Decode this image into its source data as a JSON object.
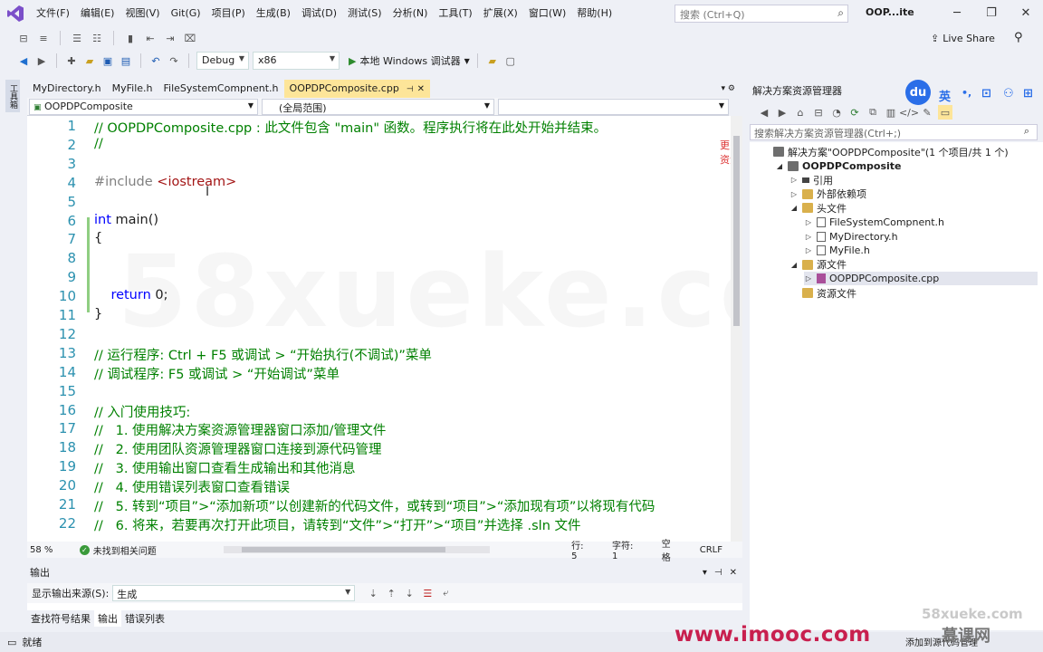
{
  "menu": [
    "文件(F)",
    "编辑(E)",
    "视图(V)",
    "Git(G)",
    "项目(P)",
    "生成(B)",
    "调试(D)",
    "测试(S)",
    "分析(N)",
    "工具(T)",
    "扩展(X)",
    "窗口(W)",
    "帮助(H)"
  ],
  "search_placeholder": "搜索 (Ctrl+Q)",
  "window_title": "OOP...ite",
  "live_share": "Live Share",
  "toolbar": {
    "config": "Debug",
    "platform": "x86",
    "run": "本地 Windows 调试器"
  },
  "left_strip_label": "工具箱",
  "editor_tabs": [
    {
      "label": "MyDirectory.h",
      "active": false
    },
    {
      "label": "MyFile.h",
      "active": false
    },
    {
      "label": "FileSystemCompnent.h",
      "active": false
    },
    {
      "label": "OOPDPComposite.cpp",
      "active": true
    }
  ],
  "nav": {
    "project": "OOPDPComposite",
    "scope": "(全局范围)"
  },
  "code_lines": [
    {
      "n": "1",
      "parts": [
        {
          "t": "// OOPDPComposite.cpp : 此文件包含 \"main\" 函数。程序执行将在此处开始并结束。",
          "c": "cmt"
        }
      ]
    },
    {
      "n": "2",
      "parts": [
        {
          "t": "//",
          "c": "cmt"
        }
      ]
    },
    {
      "n": "3",
      "parts": []
    },
    {
      "n": "4",
      "parts": [
        {
          "t": "#include ",
          "c": "pp"
        },
        {
          "t": "<iostream>",
          "c": "str"
        }
      ]
    },
    {
      "n": "5",
      "parts": []
    },
    {
      "n": "6",
      "parts": [
        {
          "t": "int",
          "c": "kw"
        },
        {
          "t": " main()",
          "c": "plain"
        }
      ]
    },
    {
      "n": "7",
      "parts": [
        {
          "t": "{",
          "c": "plain"
        }
      ]
    },
    {
      "n": "8",
      "parts": []
    },
    {
      "n": "9",
      "parts": []
    },
    {
      "n": "10",
      "parts": [
        {
          "t": "    ",
          "c": "plain"
        },
        {
          "t": "return",
          "c": "kw"
        },
        {
          "t": " 0;",
          "c": "plain"
        }
      ]
    },
    {
      "n": "11",
      "parts": [
        {
          "t": "}",
          "c": "plain"
        }
      ]
    },
    {
      "n": "12",
      "parts": []
    },
    {
      "n": "13",
      "parts": [
        {
          "t": "// 运行程序: Ctrl + F5 或调试 > “开始执行(不调试)”菜单",
          "c": "cmt"
        }
      ]
    },
    {
      "n": "14",
      "parts": [
        {
          "t": "// 调试程序: F5 或调试 > “开始调试”菜单",
          "c": "cmt"
        }
      ]
    },
    {
      "n": "15",
      "parts": []
    },
    {
      "n": "16",
      "parts": [
        {
          "t": "// 入门使用技巧:",
          "c": "cmt"
        }
      ]
    },
    {
      "n": "17",
      "parts": [
        {
          "t": "//   1. 使用解决方案资源管理器窗口添加/管理文件",
          "c": "cmt"
        }
      ]
    },
    {
      "n": "18",
      "parts": [
        {
          "t": "//   2. 使用团队资源管理器窗口连接到源代码管理",
          "c": "cmt"
        }
      ]
    },
    {
      "n": "19",
      "parts": [
        {
          "t": "//   3. 使用输出窗口查看生成输出和其他消息",
          "c": "cmt"
        }
      ]
    },
    {
      "n": "20",
      "parts": [
        {
          "t": "//   4. 使用错误列表窗口查看错误",
          "c": "cmt"
        }
      ]
    },
    {
      "n": "21",
      "parts": [
        {
          "t": "//   5. 转到“项目”>“添加新项”以创建新的代码文件，或转到“项目”>“添加现有项”以将现有代码",
          "c": "cmt"
        }
      ]
    },
    {
      "n": "22",
      "parts": [
        {
          "t": "//   6. 将来，若要再次打开此项目，请转到“文件”>“打开”>“项目”并选择 .sln 文件",
          "c": "cmt"
        }
      ]
    }
  ],
  "editor_watermark": "58xueke.com",
  "editor_overlay_text": "更多资源",
  "editor_status": {
    "zoom": "58 %",
    "issues": "未找到相关问题",
    "line": "行: 5",
    "char": "字符: 1",
    "spaces": "空格",
    "eol": "CRLF"
  },
  "output": {
    "title": "输出",
    "source_label": "显示输出来源(S):",
    "source_value": "生成"
  },
  "bottom_tabs": [
    "查找符号结果",
    "输出",
    "错误列表"
  ],
  "solution_explorer": {
    "title": "解决方案资源管理器",
    "search": "搜索解决方案资源管理器(Ctrl+;)",
    "tree": [
      {
        "label": "解决方案\"OOPDPComposite\"(1 个项目/共 1 个)",
        "icon": "sol",
        "exp": "",
        "indent": 0,
        "bold": false
      },
      {
        "label": "OOPDPComposite",
        "icon": "proj",
        "exp": "◢",
        "indent": 1,
        "bold": true
      },
      {
        "label": "引用",
        "icon": "ref",
        "exp": "▷",
        "indent": 2,
        "bold": false
      },
      {
        "label": "外部依赖项",
        "icon": "folder",
        "exp": "▷",
        "indent": 2,
        "bold": false
      },
      {
        "label": "头文件",
        "icon": "folder",
        "exp": "◢",
        "indent": 2,
        "bold": false
      },
      {
        "label": "FileSystemCompnent.h",
        "icon": "file",
        "exp": "▷",
        "indent": 3,
        "bold": false
      },
      {
        "label": "MyDirectory.h",
        "icon": "file",
        "exp": "▷",
        "indent": 3,
        "bold": false
      },
      {
        "label": "MyFile.h",
        "icon": "file",
        "exp": "▷",
        "indent": 3,
        "bold": false
      },
      {
        "label": "源文件",
        "icon": "folder",
        "exp": "◢",
        "indent": 2,
        "bold": false
      },
      {
        "label": "OOPDPComposite.cpp",
        "icon": "cpp",
        "exp": "▷",
        "indent": 3,
        "bold": false
      },
      {
        "label": "资源文件",
        "icon": "folder",
        "exp": "",
        "indent": 2,
        "bold": false
      }
    ]
  },
  "ime_badge": "du",
  "ime_lang": "英",
  "status_bar": {
    "left": "就绪",
    "right": "添加到源代码管理"
  },
  "brand": {
    "imooc": "www.imooc.com",
    "mk": "慕课网",
    "corner": "58xueke.com"
  }
}
